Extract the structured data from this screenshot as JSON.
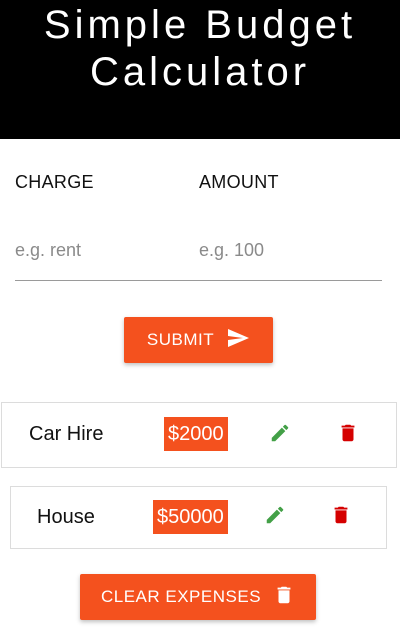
{
  "header": {
    "title": "Simple Budget Calculator"
  },
  "form": {
    "charge_label": "CHARGE",
    "amount_label": "AMOUNT",
    "charge_placeholder": "e.g. rent",
    "amount_placeholder": "e.g. 100",
    "charge_value": "",
    "amount_value": "",
    "submit_label": "SUBMIT",
    "submit_icon": "send-icon"
  },
  "expenses": [
    {
      "name": "Car Hire",
      "amount": "$2000",
      "edit_icon": "pencil-icon",
      "delete_icon": "trash-icon"
    },
    {
      "name": "House",
      "amount": "$50000",
      "edit_icon": "pencil-icon",
      "delete_icon": "trash-icon"
    }
  ],
  "actions": {
    "clear_label": "CLEAR EXPENSES",
    "clear_icon": "trash-icon"
  },
  "colors": {
    "header_bg": "#000000",
    "accent": "#f4511e",
    "edit_icon": "#43a047",
    "delete_icon": "#d50000"
  }
}
